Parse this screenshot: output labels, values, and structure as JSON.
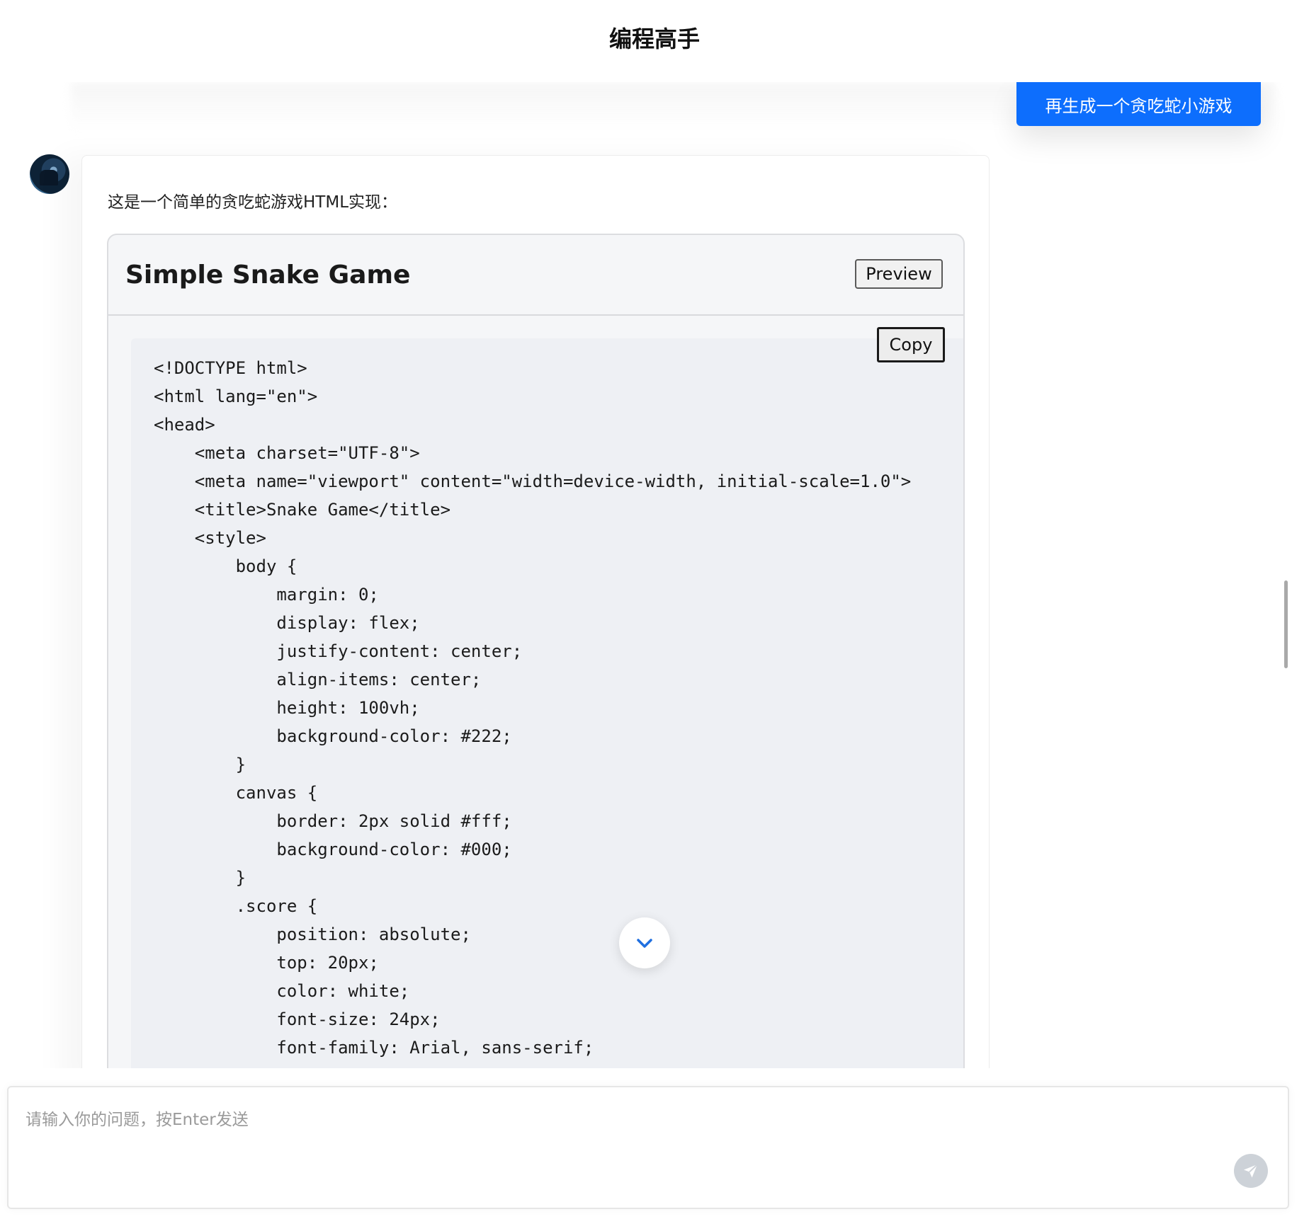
{
  "header": {
    "title": "编程高手"
  },
  "user_message": {
    "text": "再生成一个贪吃蛇小游戏"
  },
  "assistant": {
    "intro": "这是一个简单的贪吃蛇游戏HTML实现：",
    "code_card": {
      "title": "Simple Snake Game",
      "preview_label": "Preview",
      "copy_label": "Copy",
      "lines": [
        "<!DOCTYPE html>",
        "<html lang=\"en\">",
        "<head>",
        "    <meta charset=\"UTF-8\">",
        "    <meta name=\"viewport\" content=\"width=device-width, initial-scale=1.0\">",
        "    <title>Snake Game</title>",
        "    <style>",
        "        body {",
        "            margin: 0;",
        "            display: flex;",
        "            justify-content: center;",
        "            align-items: center;",
        "            height: 100vh;",
        "            background-color: #222;",
        "        }",
        "        canvas {",
        "            border: 2px solid #fff;",
        "            background-color: #000;",
        "        }",
        "        .score {",
        "            position: absolute;",
        "            top: 20px;",
        "            color: white;",
        "            font-size: 24px;",
        "            font-family: Arial, sans-serif;"
      ]
    }
  },
  "input": {
    "placeholder": "请输入你的问题，按Enter发送",
    "value": ""
  },
  "icons": {
    "avatar": "user-avatar",
    "scroll_down": "chevron-down-icon",
    "send": "send-icon"
  },
  "colors": {
    "user_bubble": "#0d6efd",
    "send_button": "#cdd2d8",
    "scroll_chevron": "#1f6fe0"
  }
}
